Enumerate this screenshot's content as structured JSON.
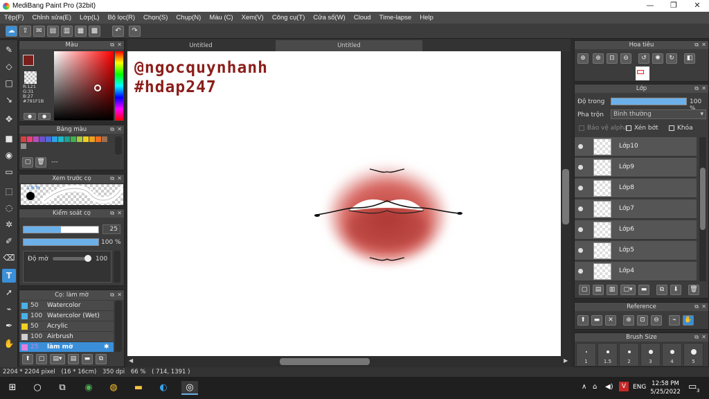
{
  "window": {
    "title": "MediBang Paint Pro (32bit)",
    "controls": [
      "—",
      "❐",
      "✕"
    ]
  },
  "menu": [
    "Tệp(F)",
    "Chỉnh sửa(E)",
    "Lớp(L)",
    "Bộ lọc(R)",
    "Chọn(S)",
    "Chụp(N)",
    "Màu (C)",
    "Xem(V)",
    "Công cụ(T)",
    "Cửa sổ(W)",
    "Cloud",
    "Time-lapse",
    "Help"
  ],
  "tabs": [
    "Untitled",
    "Untitled"
  ],
  "color_panel": {
    "title": "Màu",
    "r": "R:121",
    "g": "G:31",
    "b": "B:27",
    "hex": "#791F1B",
    "color": "#791F1B"
  },
  "palette_panel": {
    "title": "Bảng màu",
    "dots": "---",
    "swatches": [
      "#d84040",
      "#e8407a",
      "#b04fc0",
      "#7050c8",
      "#4a6cd8",
      "#2da0e8",
      "#20b8c8",
      "#20a090",
      "#40b050",
      "#a8c840",
      "#f0d020",
      "#f0a020",
      "#f07020",
      "#a07050",
      "#909090"
    ]
  },
  "brush_preview": {
    "title": "Xem trước cọ",
    "size_label": "1.8 In"
  },
  "brush_control": {
    "title": "Kiểm soát cọ",
    "size_value": "25",
    "opacity_value": "100 %",
    "blur_label": "Độ mờ",
    "blur_value": "100",
    "size_fraction": 0.5,
    "opacity_fraction": 1.0,
    "blur_fraction": 1.0
  },
  "brush_list": {
    "title": "Cọ: làm mờ",
    "items": [
      {
        "size": "50",
        "name": "Watercolor",
        "color": "#4ab0e8"
      },
      {
        "size": "100",
        "name": "Watercolor (Wet)",
        "color": "#4ab0e8"
      },
      {
        "size": "50",
        "name": "Acrylic",
        "color": "#f0d020"
      },
      {
        "size": "100",
        "name": "Airbrush",
        "color": "#cfcfcf"
      },
      {
        "size": "25",
        "name": "làm mờ",
        "color": "#e080e0"
      }
    ]
  },
  "canvas": {
    "text_line1": "@ngocquynhanh",
    "text_line2": "#hdap247",
    "text_color": "#8b1e1a"
  },
  "navigator": {
    "title": "Hoa tiêu"
  },
  "layer_panel": {
    "title": "Lớp",
    "opacity_label": "Độ trong",
    "opacity_value": "100 %",
    "opacity_fraction": 1.0,
    "blend_label": "Pha trộn",
    "blend_value": "Bình thường",
    "protect_alpha": "Bảo vệ alpha",
    "clip": "Xén bớt",
    "lock": "Khóa",
    "layers": [
      "Lớp10",
      "Lớp9",
      "Lớp8",
      "Lớp7",
      "Lớp6",
      "Lớp5",
      "Lớp4"
    ]
  },
  "reference_panel": {
    "title": "Reference"
  },
  "brush_size_panel": {
    "title": "Brush Size",
    "sizes": [
      "1",
      "1.5",
      "2",
      "3",
      "4",
      "5"
    ]
  },
  "status": {
    "dims": "2204 * 2204 pixel",
    "cm": "(16 * 16cm)",
    "dpi": "350 dpi",
    "zoom": "66 %",
    "coords": "( 714, 1391 )"
  },
  "taskbar": {
    "lang": "ENG",
    "time": "12:58 PM",
    "date": "5/25/2022",
    "notif_count": "3"
  }
}
